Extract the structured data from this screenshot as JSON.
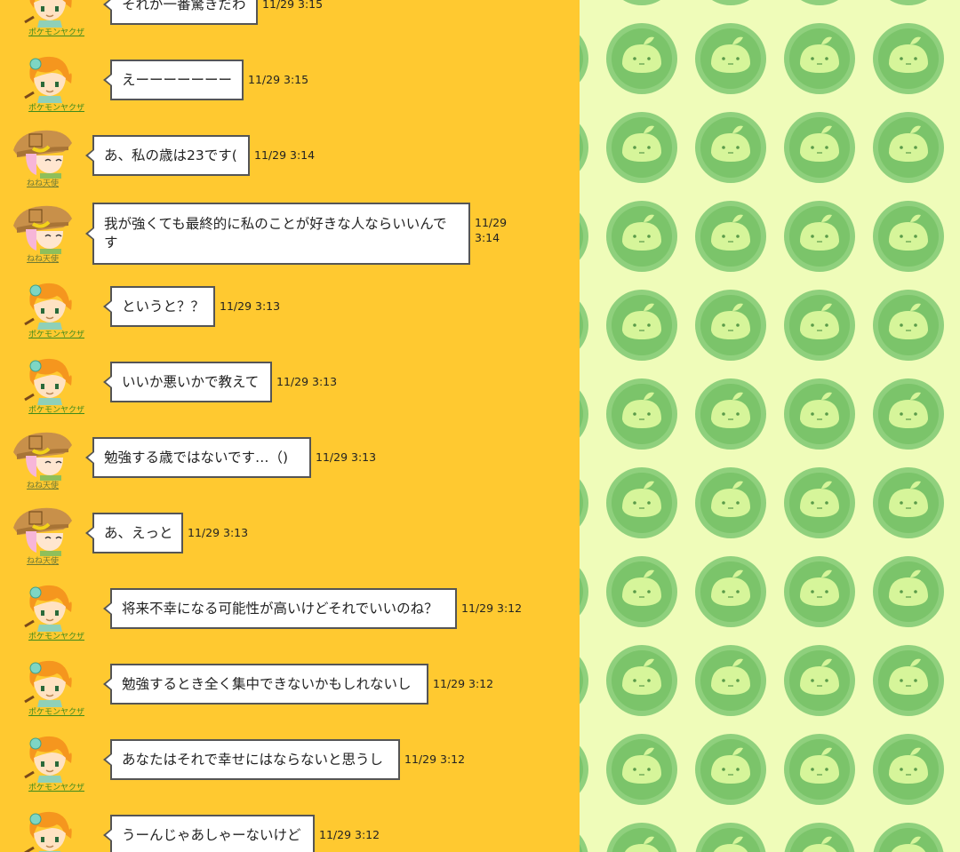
{
  "users": {
    "pokemon": {
      "name": "ポケモンヤクザ",
      "avatar": "orange-hair-boy-avatar"
    },
    "nene": {
      "name": "ねね天使",
      "avatar": "straw-hat-girl-avatar"
    }
  },
  "messages": [
    {
      "user": "pokemon",
      "text": "それが一番驚きだわ",
      "time": "11/29 3:15"
    },
    {
      "user": "pokemon",
      "text": "えーーーーーーー",
      "time": "11/29 3:15"
    },
    {
      "user": "nene",
      "text": "あ、私の歳は23です(",
      "time": "11/29 3:14"
    },
    {
      "user": "nene",
      "text": "我が強くても最終的に私のことが好きな人ならいいんです",
      "time": "11/29 3:14"
    },
    {
      "user": "pokemon",
      "text": "というと？？",
      "time": "11/29 3:13"
    },
    {
      "user": "pokemon",
      "text": "いいか悪いかで教えて",
      "time": "11/29 3:13"
    },
    {
      "user": "nene",
      "text": "勉強する歳ではないです…（)",
      "time": "11/29 3:13"
    },
    {
      "user": "nene",
      "text": "あ、えっと",
      "time": "11/29 3:13"
    },
    {
      "user": "pokemon",
      "text": "将来不幸になる可能性が高いけどそれでいいのね？",
      "time": "11/29 3:12"
    },
    {
      "user": "pokemon",
      "text": "勉強するとき全く集中できないかもしれないし",
      "time": "11/29 3:12"
    },
    {
      "user": "pokemon",
      "text": "あなたはそれで幸せにはならないと思うし",
      "time": "11/29 3:12"
    },
    {
      "user": "pokemon",
      "text": "うーんじゃあしゃーないけど",
      "time": "11/29 3:12"
    }
  ],
  "colors": {
    "chat_bg": "#FFC930",
    "pattern_bg": "#EFFCB9",
    "coin_outer": "#8FD07D",
    "coin_inner": "#7BC46A",
    "mascot": "#D6F59A"
  },
  "pattern_icon": "green-sprout-blob-coin-icon"
}
